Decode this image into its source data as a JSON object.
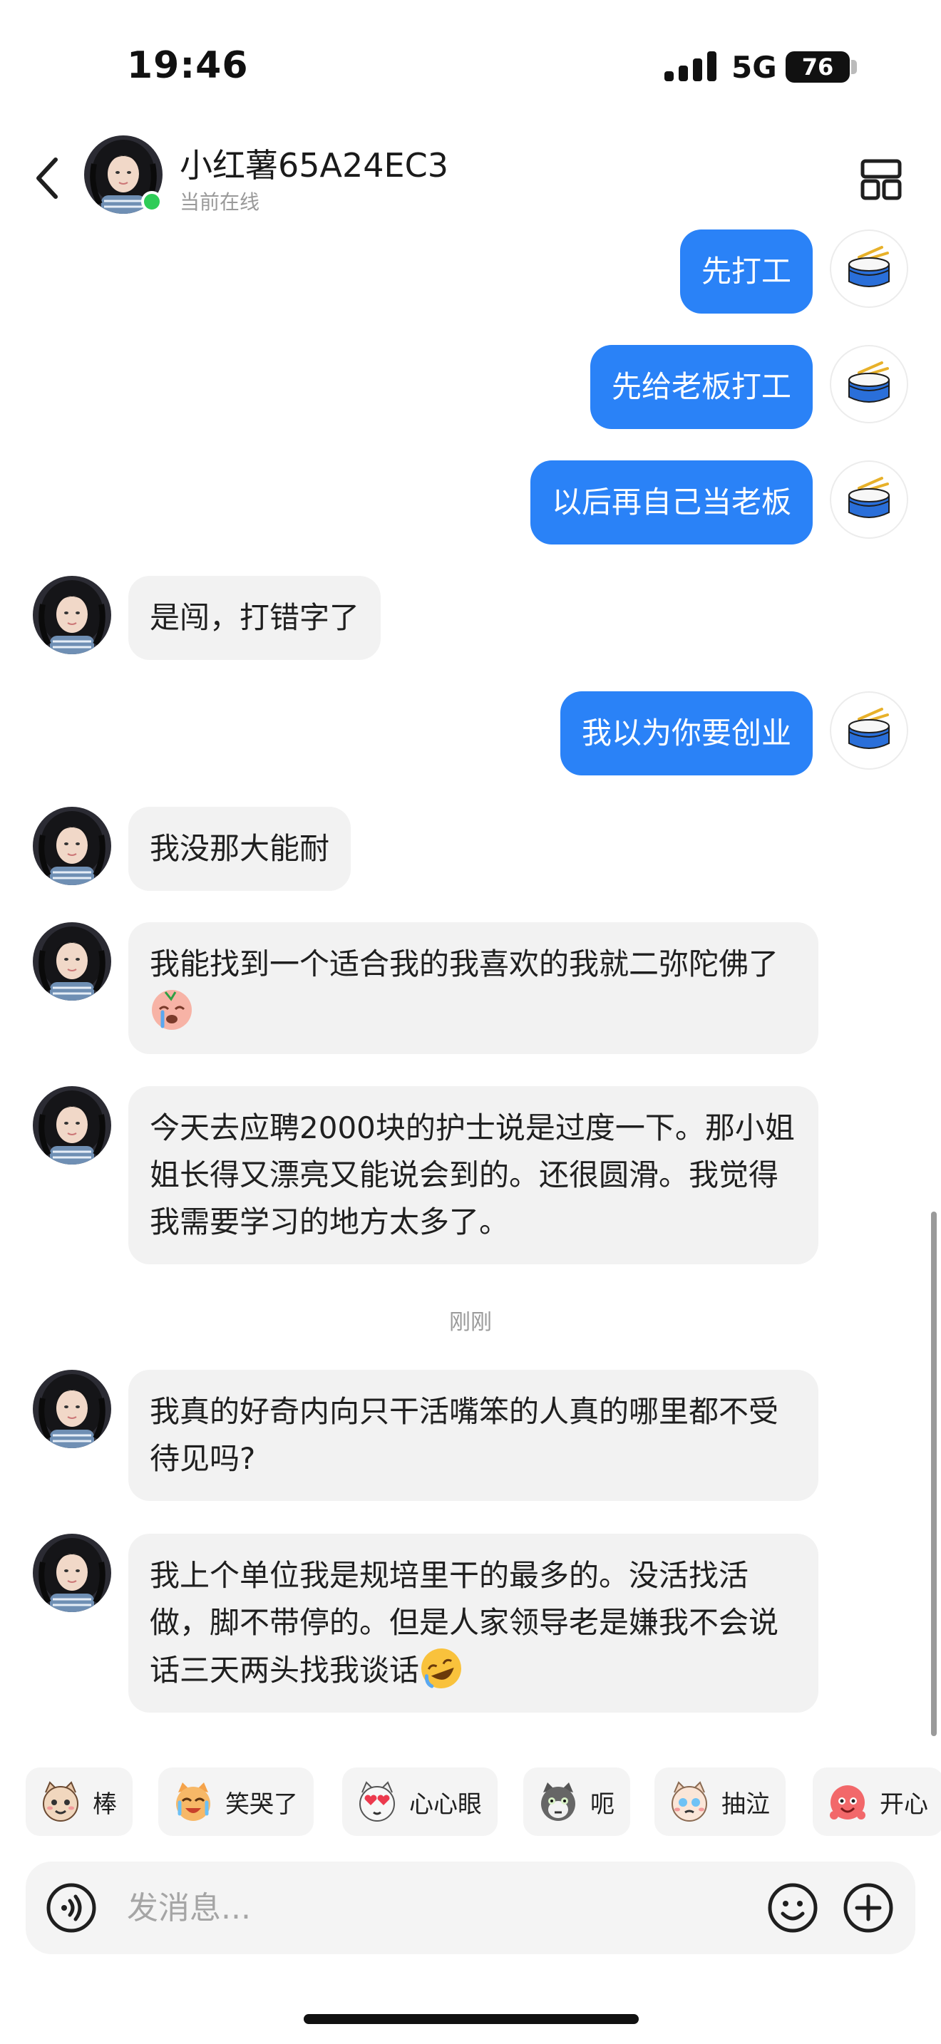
{
  "status_bar": {
    "time": "19:46",
    "network": "5G",
    "battery": "76"
  },
  "header": {
    "name": "小红薯65A24EC3",
    "status": "当前在线"
  },
  "messages": [
    {
      "from": "me",
      "text": "先打工"
    },
    {
      "from": "me",
      "text": "先给老板打工"
    },
    {
      "from": "me",
      "text": "以后再自己当老板"
    },
    {
      "from": "them",
      "text": "是闯，打错字了"
    },
    {
      "from": "me",
      "text": "我以为你要创业"
    },
    {
      "from": "them",
      "text": "我没那大能耐"
    },
    {
      "from": "them",
      "text": "我能找到一个适合我的我喜欢的我就二弥陀佛了"
    },
    {
      "from": "them",
      "text": "今天去应聘2000块的护士说是过度一下。那小姐姐长得又漂亮又能说会到的。还很圆滑。我觉得我需要学习的地方太多了。"
    },
    {
      "from": "them",
      "text": "我真的好奇内向只干活嘴笨的人真的哪里都不受待见吗?"
    },
    {
      "from": "them",
      "text": "我上个单位我是规培里干的最多的。没活找活做，脚不带停的。但是人家领导老是嫌我不会说话三天两头找我谈话"
    }
  ],
  "timestamp": "刚刚",
  "quick_reactions": [
    {
      "label": "棒",
      "icon": "cat-face-icon"
    },
    {
      "label": "笑哭了",
      "icon": "laugh-cry-cat-icon"
    },
    {
      "label": "心心眼",
      "icon": "heart-eyes-cat-icon"
    },
    {
      "label": "呃",
      "icon": "gray-cat-icon"
    },
    {
      "label": "抽泣",
      "icon": "sobbing-cat-icon"
    },
    {
      "label": "开心",
      "icon": "happy-red-icon"
    }
  ],
  "input": {
    "placeholder": "发消息..."
  },
  "icons": {
    "back": "chevron-left-icon",
    "layout": "grid-layout-icon",
    "voice": "voice-icon",
    "emoji": "smiley-icon",
    "plus": "plus-icon",
    "my_avatar": "drum-icon",
    "emoji_in_message_1": "crying-face-icon",
    "emoji_in_message_2": "rofl-face-icon"
  },
  "colors": {
    "my_bubble": "#2a82f7",
    "their_bubble": "#f2f2f2",
    "online": "#2ecc57"
  }
}
